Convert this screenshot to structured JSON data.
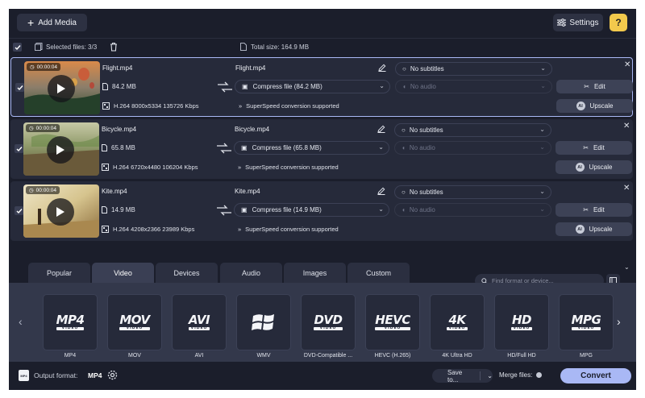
{
  "toolbar": {
    "add_media": "Add Media",
    "settings": "Settings",
    "help": "?"
  },
  "status": {
    "selected_label": "Selected files: 3/3",
    "total_label": "Total size: 164.9 MB"
  },
  "files": [
    {
      "duration": "00:00:04",
      "name": "Flight.mp4",
      "size": "84.2 MB",
      "meta": "H.264 8000x5334 135726 Kbps",
      "output_name": "Flight.mp4",
      "compress": "Compress file (84.2 MB)",
      "superspeed": "SuperSpeed conversion supported",
      "subtitles": "No subtitles",
      "audio": "No audio",
      "edit": "Edit",
      "upscale": "Upscale",
      "ai": "AI"
    },
    {
      "duration": "00:00:04",
      "name": "Bicycle.mp4",
      "size": "65.8 MB",
      "meta": "H.264 6720x4480 106204 Kbps",
      "output_name": "Bicycle.mp4",
      "compress": "Compress file (65.8 MB)",
      "superspeed": "SuperSpeed conversion supported",
      "subtitles": "No subtitles",
      "audio": "No audio",
      "edit": "Edit",
      "upscale": "Upscale",
      "ai": "AI"
    },
    {
      "duration": "00:00:04",
      "name": "Kite.mp4",
      "size": "14.9 MB",
      "meta": "H.264 4208x2366 23989 Kbps",
      "output_name": "Kite.mp4",
      "compress": "Compress file (14.9 MB)",
      "superspeed": "SuperSpeed conversion supported",
      "subtitles": "No subtitles",
      "audio": "No audio",
      "edit": "Edit",
      "upscale": "Upscale",
      "ai": "AI"
    }
  ],
  "tabs": [
    "Popular",
    "Video",
    "Devices",
    "Audio",
    "Images",
    "Custom"
  ],
  "active_tab": "Video",
  "search": {
    "placeholder": "Find format or device..."
  },
  "formats": [
    {
      "logo": "MP4",
      "sub": "VIDEO",
      "label": "MP4"
    },
    {
      "logo": "MOV",
      "sub": "VIDEO",
      "label": "MOV"
    },
    {
      "logo": "AVI",
      "sub": "VIDEO",
      "label": "AVI"
    },
    {
      "logo": "",
      "sub": "",
      "label": "WMV",
      "icon": "windows-logo"
    },
    {
      "logo": "DVD",
      "sub": "VIDEO",
      "label": "DVD-Compatible ..."
    },
    {
      "logo": "HEVC",
      "sub": "VIDEO",
      "label": "HEVC (H.265)"
    },
    {
      "logo": "4K",
      "sub": "VIDEO",
      "label": "4K Ultra HD"
    },
    {
      "logo": "HD",
      "sub": "VIDEO",
      "label": "HD/Full HD"
    },
    {
      "logo": "MPG",
      "sub": "VIDEO",
      "label": "MPG"
    }
  ],
  "bottom": {
    "output_label": "Output format:",
    "output_value": "MP4",
    "save_to": "Save to...",
    "merge": "Merge files:",
    "convert": "Convert",
    "format_icon_text": "MP4"
  },
  "colors": {
    "accent": "#a9b8f5",
    "help": "#f2c94c",
    "background": "#1f2231"
  }
}
